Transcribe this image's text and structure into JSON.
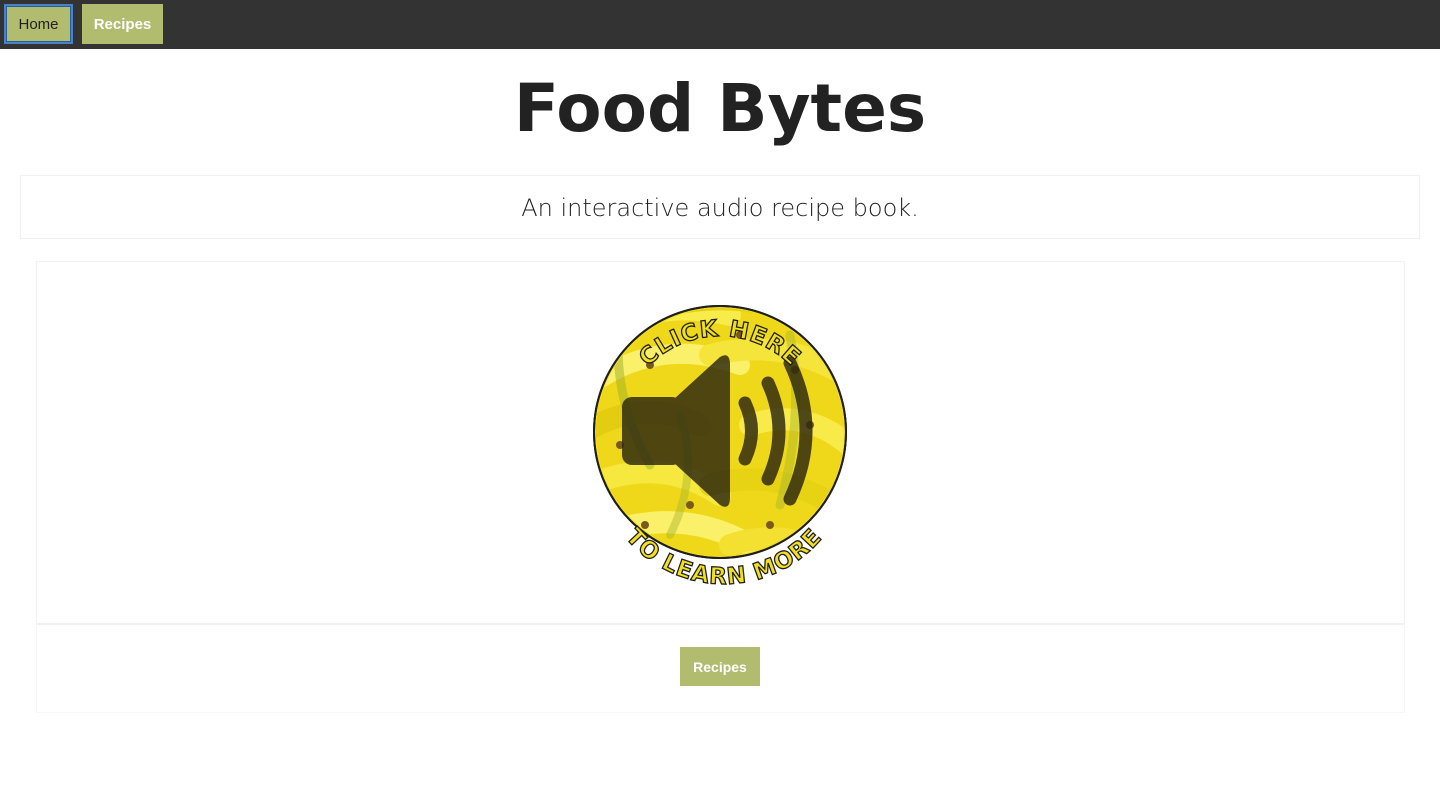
{
  "nav": {
    "home_label": "Home",
    "recipes_label": "Recipes"
  },
  "header": {
    "title": "Food Bytes",
    "subtitle": "An interactive audio recipe book."
  },
  "audio_prompt": {
    "top_text": "CLICK HERE",
    "bottom_text": "TO LEARN MORE",
    "icon": "speaker-icon"
  },
  "footer": {
    "recipes_button_label": "Recipes"
  },
  "colors": {
    "nav_bg": "#333333",
    "button_bg": "#b2bc6e",
    "banana_yellow": "#f2e01e"
  }
}
